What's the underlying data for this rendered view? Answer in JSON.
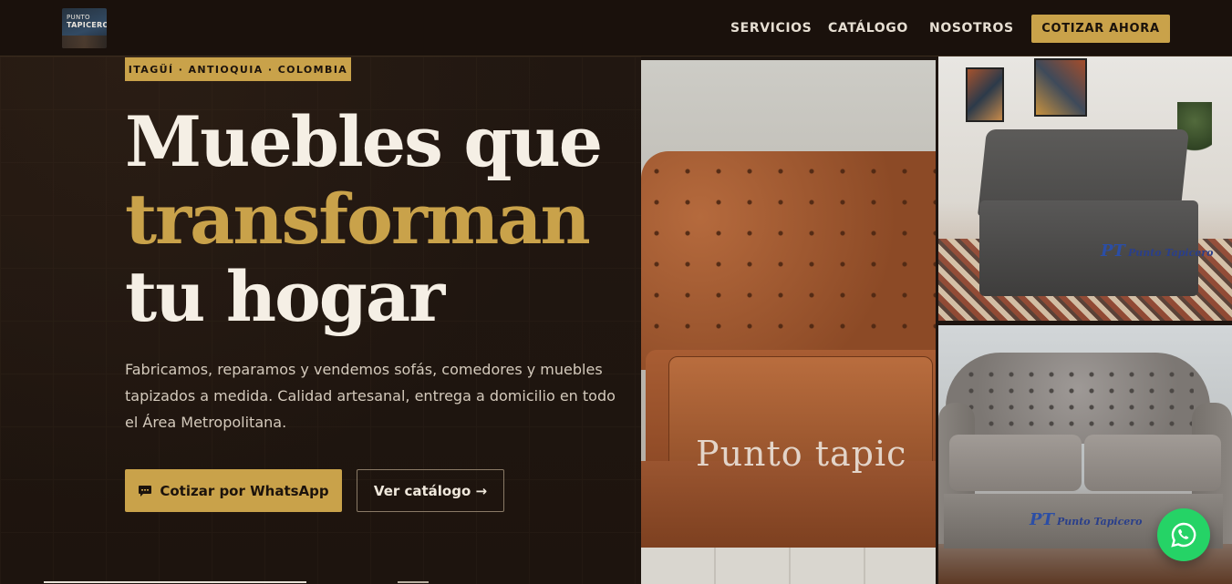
{
  "brand": {
    "logo_line1": "PUNTO",
    "logo_line2": "TAPICERO"
  },
  "nav": {
    "links": [
      "SERVICIOS",
      "CATÁLOGO",
      "NOSOTROS"
    ],
    "cta": "COTIZAR AHORA"
  },
  "hero": {
    "badge": "ITAGÜÍ · ANTIOQUIA · COLOMBIA",
    "headline_line1": "Muebles que",
    "headline_line2": "transforman",
    "headline_line3": "tu hogar",
    "lead": "Fabricamos, reparamos y vendemos sofás, comedores y muebles tapizados a medida. Calidad artesanal, entrega a domicilio en todo el Área Metropolitana.",
    "primary_button": "Cotizar por WhatsApp",
    "secondary_button": "Ver catálogo →"
  },
  "gallery": {
    "photo1_watermark": "Punto tapic",
    "photo2_watermark_initials": "PT",
    "photo2_watermark_text": "Punto Tapicero",
    "photo3_watermark_initials": "PT",
    "photo3_watermark_text": "Punto Tapicero"
  },
  "colors": {
    "accent": "#c9a24a",
    "background": "#1e1510",
    "whatsapp": "#25d366"
  },
  "icons": {
    "primary_button_icon": "chat-bubble-icon",
    "floating_button_icon": "whatsapp-icon"
  }
}
